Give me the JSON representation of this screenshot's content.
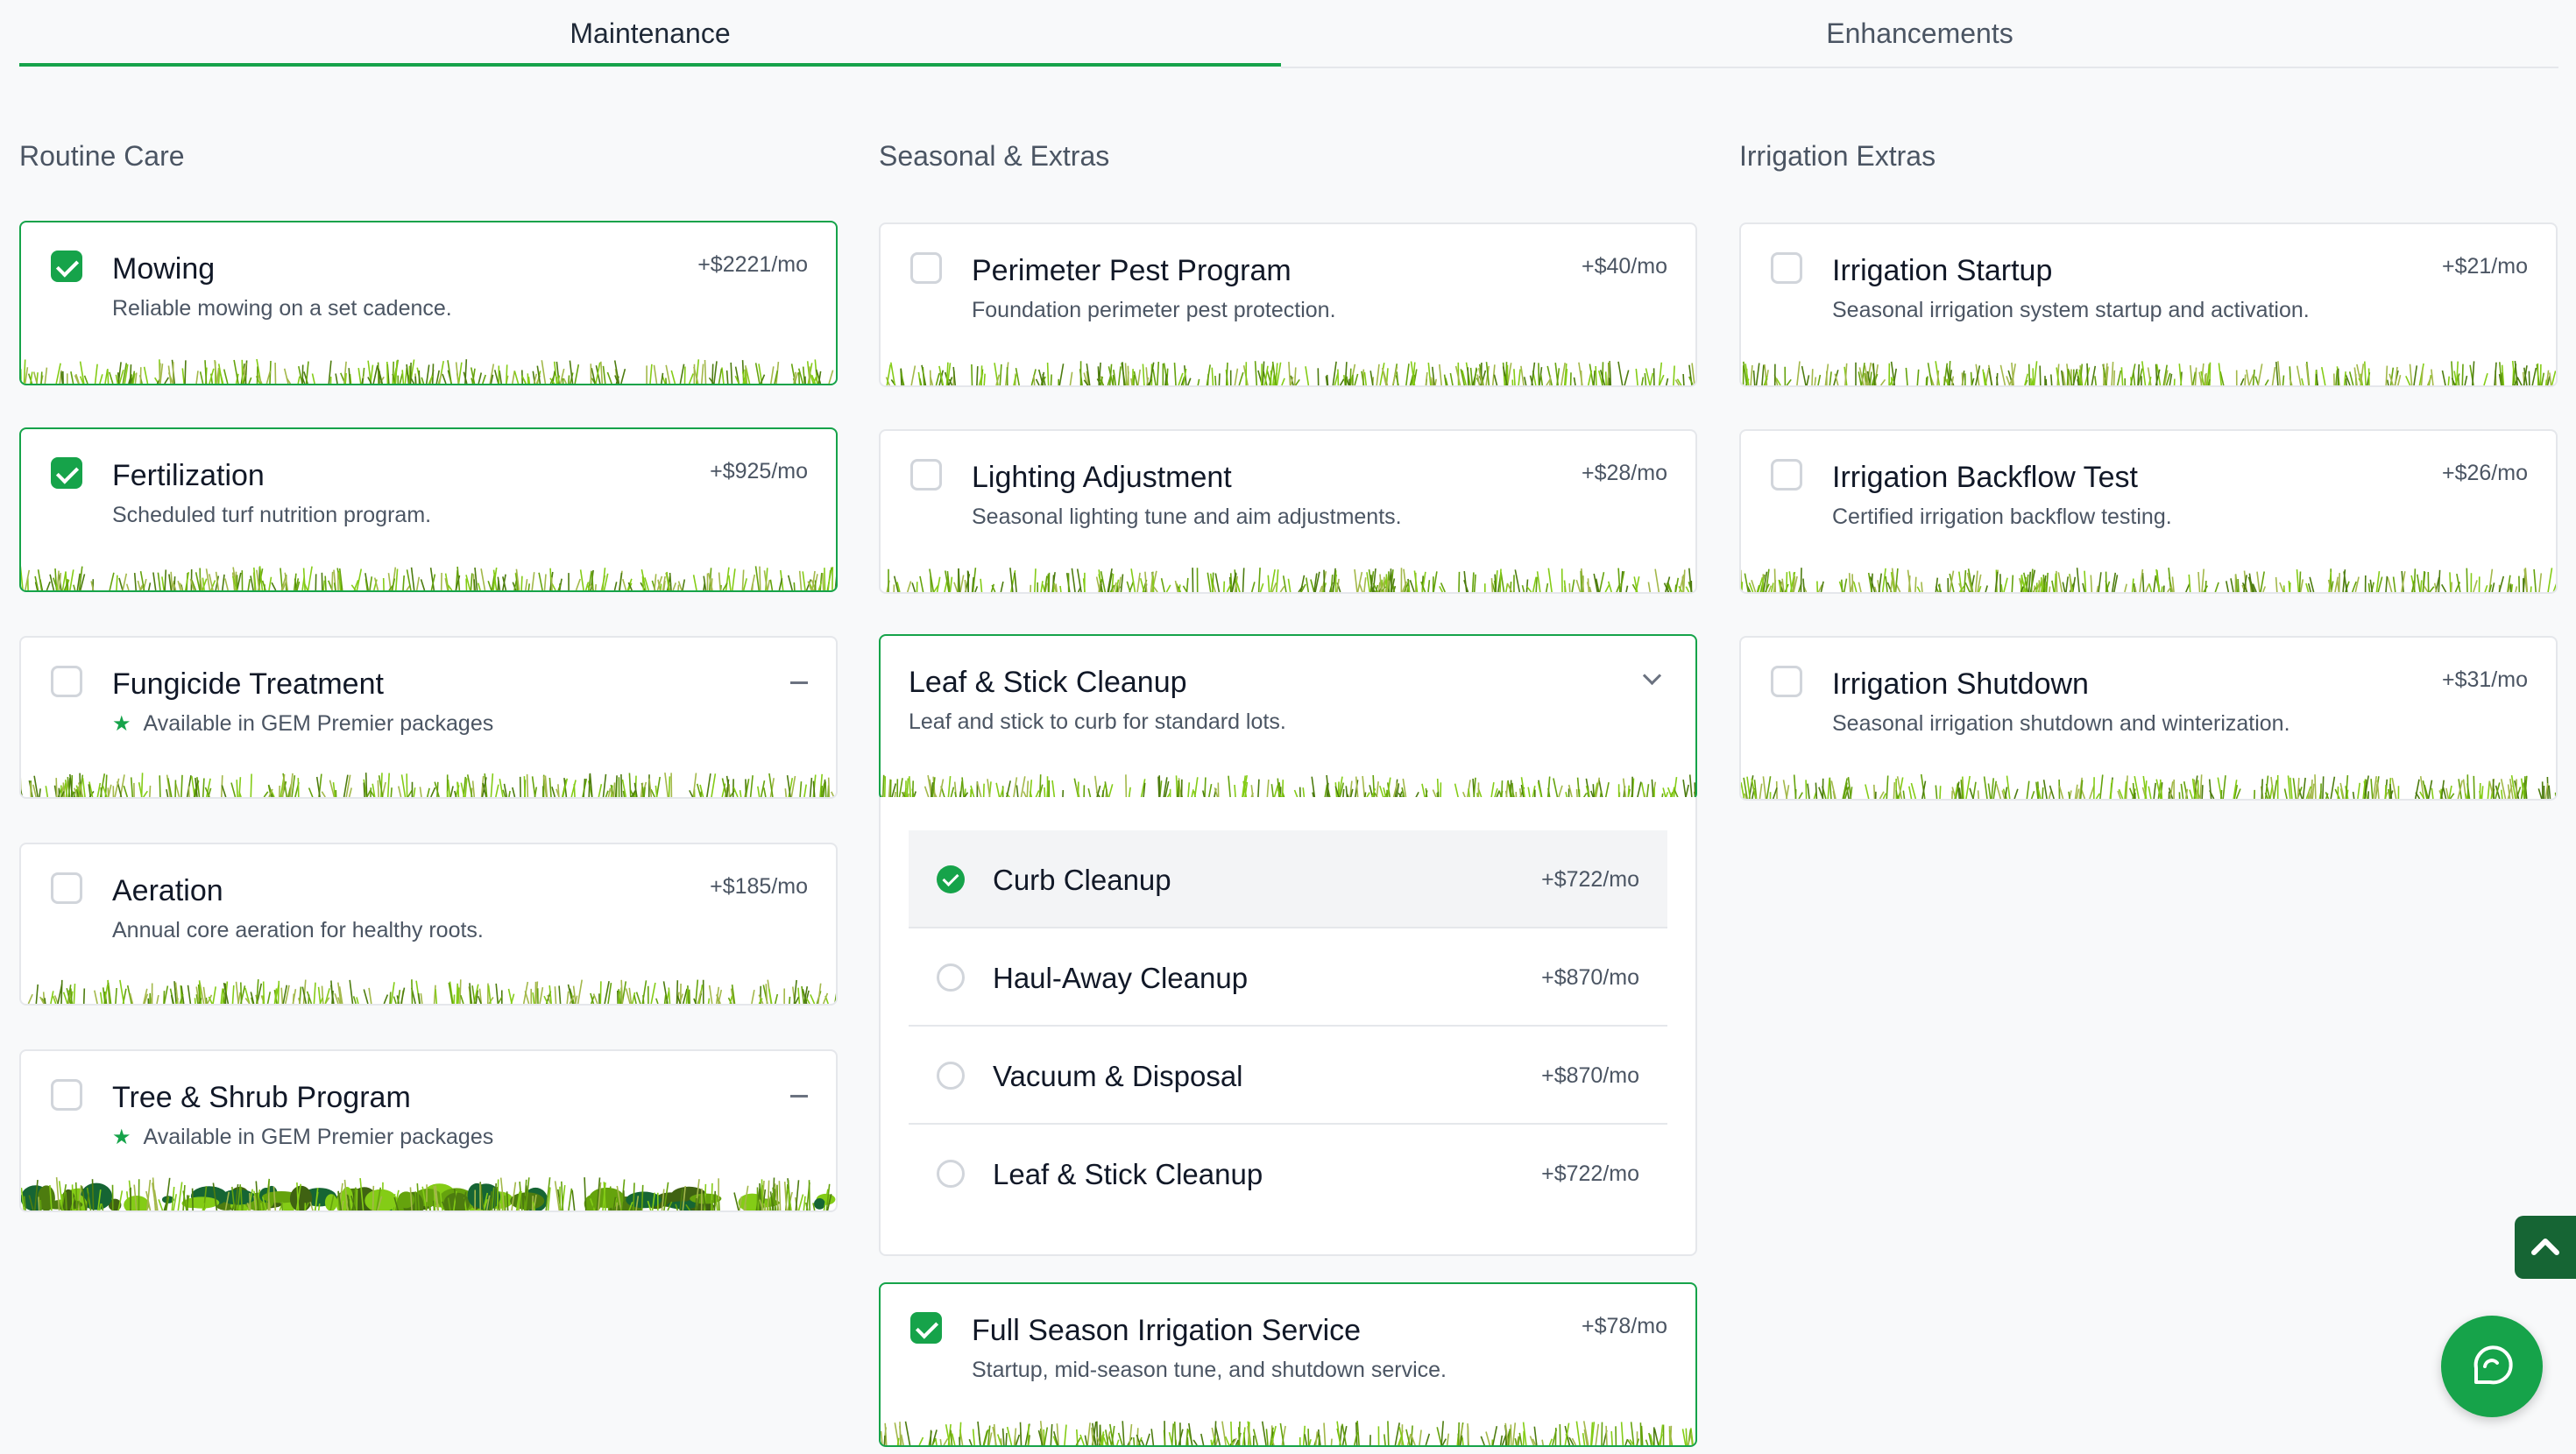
{
  "tabs": {
    "maintenance": "Maintenance",
    "enhancements": "Enhancements"
  },
  "colors": {
    "accent": "#16a34a",
    "dark_accent": "#166534"
  },
  "columns": {
    "routine": {
      "title": "Routine Care",
      "cards": [
        {
          "title": "Mowing",
          "desc": "Reliable mowing on a set cadence.",
          "price": "+$2221/mo",
          "checked": true
        },
        {
          "title": "Fertilization",
          "desc": "Scheduled turf nutrition program.",
          "price": "+$925/mo",
          "checked": true
        },
        {
          "title": "Fungicide Treatment",
          "desc": "Available in GEM Premier packages",
          "price": "",
          "checked": false
        },
        {
          "title": "Aeration",
          "desc": "Annual core aeration for healthy roots.",
          "price": "+$185/mo",
          "checked": false
        },
        {
          "title": "Tree & Shrub Program",
          "desc": "Available in GEM Premier packages",
          "price": "",
          "checked": false
        }
      ]
    },
    "seasonal": {
      "title": "Seasonal & Extras",
      "cards": [
        {
          "title": "Perimeter Pest Program",
          "desc": "Foundation perimeter pest protection.",
          "price": "+$40/mo",
          "checked": false
        },
        {
          "title": "Lighting Adjustment",
          "desc": "Seasonal lighting tune and aim adjustments.",
          "price": "+$28/mo",
          "checked": false
        },
        {
          "title": "Leaf & Stick Cleanup",
          "desc": "Leaf and stick to curb for standard lots.",
          "price": "",
          "checked": false
        },
        {
          "title": "Full Season Irrigation Service",
          "desc": "Startup, mid-season tune, and shutdown service.",
          "price": "+$78/mo",
          "checked": true
        }
      ],
      "cleanup_options": [
        {
          "label": "Curb Cleanup",
          "price": "+$722/mo",
          "selected": true
        },
        {
          "label": "Haul-Away Cleanup",
          "price": "+$870/mo",
          "selected": false
        },
        {
          "label": "Vacuum & Disposal",
          "price": "+$870/mo",
          "selected": false
        },
        {
          "label": "Leaf & Stick Cleanup",
          "price": "+$722/mo",
          "selected": false
        }
      ]
    },
    "irrigation": {
      "title": "Irrigation Extras",
      "cards": [
        {
          "title": "Irrigation Startup",
          "desc": "Seasonal irrigation system startup and activation.",
          "price": "+$21/mo",
          "checked": false
        },
        {
          "title": "Irrigation Backflow Test",
          "desc": "Certified irrigation backflow testing.",
          "price": "+$26/mo",
          "checked": false
        },
        {
          "title": "Irrigation Shutdown",
          "desc": "Seasonal irrigation shutdown and winterization.",
          "price": "+$31/mo",
          "checked": false
        }
      ]
    }
  },
  "icons": {
    "premium": "star-icon",
    "scroll_top": "chevron-up-icon",
    "chat": "chat-icon"
  }
}
